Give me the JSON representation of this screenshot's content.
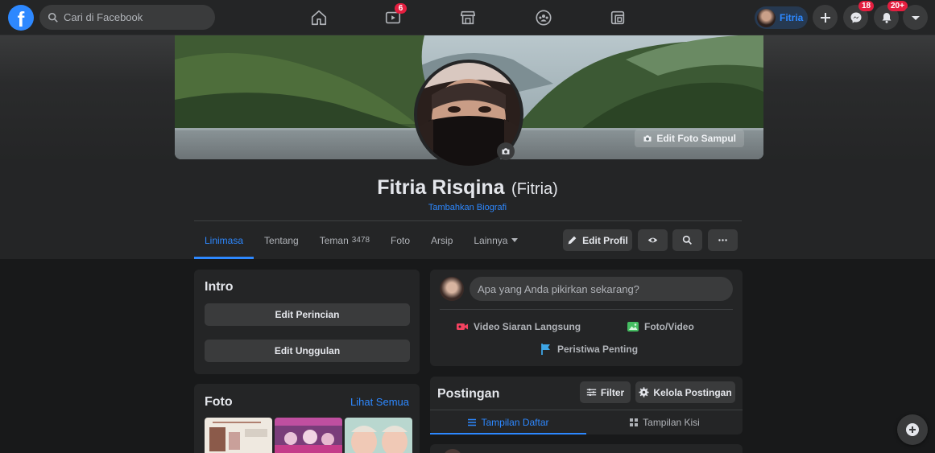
{
  "topbar": {
    "logo": "f",
    "search_placeholder": "Cari di Facebook",
    "nav_icons": [
      "home-icon",
      "watch-icon",
      "marketplace-icon",
      "groups-icon",
      "gaming-icon"
    ],
    "watch_badge": "6",
    "profile_name": "Fitria",
    "messenger_badge": "18",
    "notifications_badge": "20+",
    "colors": {
      "accent": "#2d88ff",
      "badge": "#e41e3f"
    }
  },
  "profile": {
    "edit_cover_label": "Edit Foto Sampul",
    "name": "Fitria Risqina",
    "alt_name": "(Fitria)",
    "bio_link": "Tambahkan Biografi",
    "tabs": [
      {
        "label": "Linimasa",
        "active": true
      },
      {
        "label": "Tentang"
      },
      {
        "label": "Teman",
        "count": "3478"
      },
      {
        "label": "Foto"
      },
      {
        "label": "Arsip"
      },
      {
        "label": "Lainnya"
      }
    ],
    "edit_profile_label": "Edit Profil"
  },
  "intro": {
    "title": "Intro",
    "edit_details_label": "Edit Perincian",
    "edit_featured_label": "Edit Unggulan"
  },
  "photos": {
    "title": "Foto",
    "see_all": "Lihat Semua"
  },
  "composer": {
    "placeholder": "Apa yang Anda pikirkan sekarang?",
    "live_label": "Video Siaran Langsung",
    "photo_label": "Foto/Video",
    "event_label": "Peristiwa Penting"
  },
  "posts": {
    "title": "Postingan",
    "filter_label": "Filter",
    "manage_label": "Kelola Postingan",
    "list_view_label": "Tampilan Daftar",
    "grid_view_label": "Tampilan Kisi"
  }
}
